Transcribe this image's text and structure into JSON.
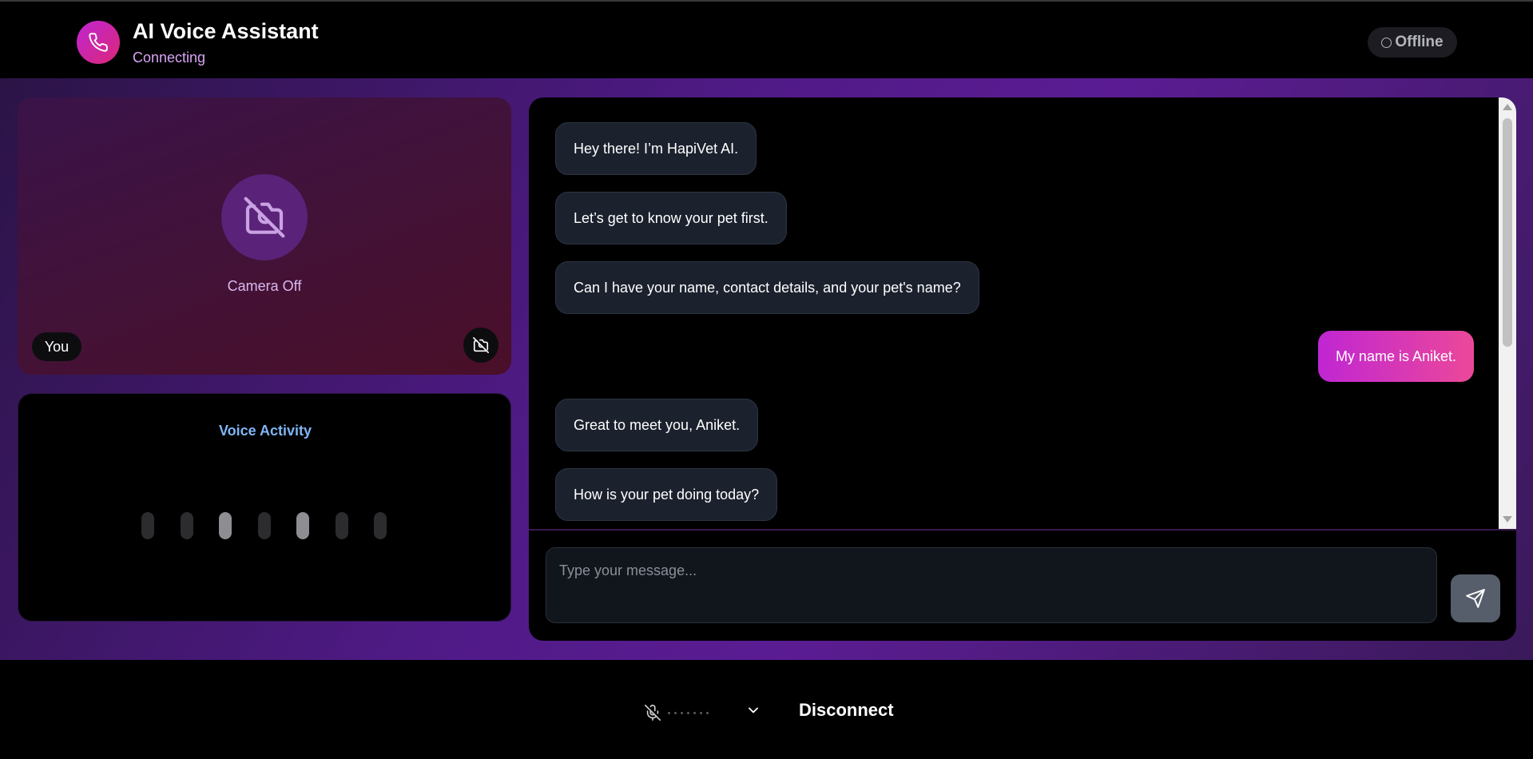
{
  "header": {
    "title": "AI Voice Assistant",
    "subtitle": "Connecting",
    "status_label": "Offline",
    "logo_icon": "phone-icon"
  },
  "camera": {
    "label": "Camera Off",
    "you_label": "You",
    "icon": "camera-off-icon"
  },
  "voice": {
    "title": "Voice Activity",
    "levels": [
      0.15,
      0.25,
      0.6,
      0.15,
      0.6,
      0.25,
      0.15
    ]
  },
  "chat": {
    "messages": [
      {
        "role": "assistant",
        "text": "Hey there! I’m HapiVet AI."
      },
      {
        "role": "assistant",
        "text": "Let’s get to know your pet first."
      },
      {
        "role": "assistant",
        "text": "Can I have your name, contact details, and your pet's name?"
      },
      {
        "role": "user",
        "text": "My name is Aniket."
      },
      {
        "role": "assistant",
        "text": "Great to meet you, Aniket."
      },
      {
        "role": "assistant",
        "text": "How is your pet doing today?"
      }
    ],
    "input_placeholder": "Type your message...",
    "send_icon": "send-icon"
  },
  "controls": {
    "mic_icon": "mic-off-icon",
    "device_menu_icon": "chevron-down-icon",
    "disconnect_label": "Disconnect"
  },
  "colors": {
    "accent_start": "#c026d3",
    "accent_end": "#ec4899",
    "voice_title": "#7fb6f6"
  }
}
